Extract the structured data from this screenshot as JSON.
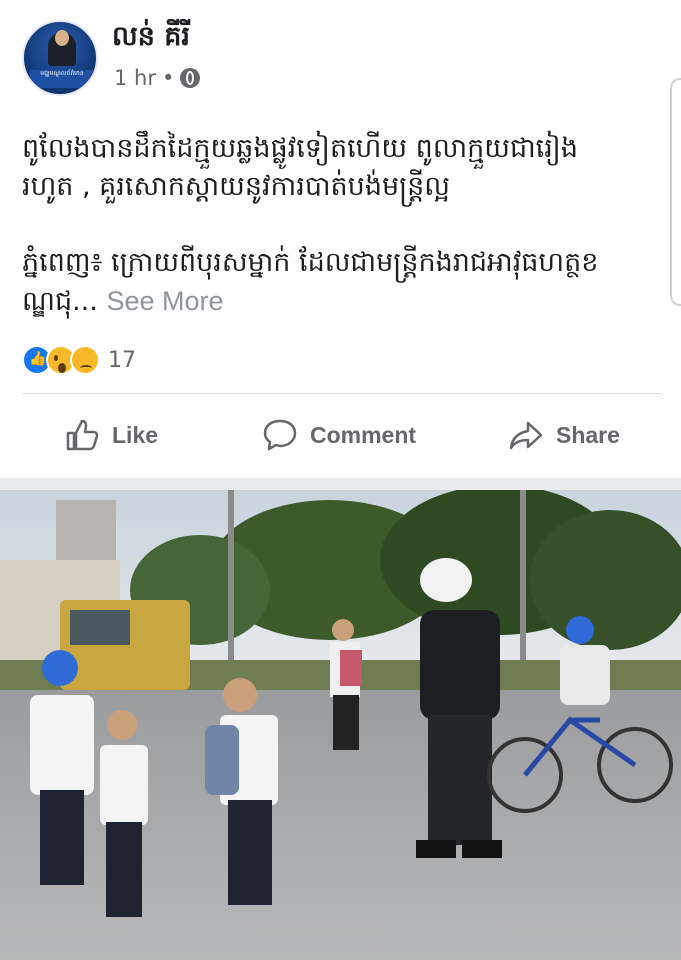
{
  "post": {
    "author": "លន់ គីរី",
    "timestamp": "1 hr",
    "separator": "•",
    "avatar_caption": "មជ្ឈមណ្ឌលព័ត៌មាន",
    "text_line1": "ពូលែងបានដឹកដៃក្មួយឆ្លងផ្លូវទៀតហើយ ពូលាក្មួយជារៀង",
    "text_line2": "រហូត , គួរសោកស្ដាយនូវការបាត់បង់មន្ត្រីល្អ",
    "text_line3": "ភ្នំពេញ៖ ក្រោយពីបុរសម្នាក់ ដែលជាមន្ត្រីកងរាជអាវុធហត្ថខ",
    "text_line4": "ណ្ឌជុ...",
    "see_more": "See More",
    "reaction_count": "17"
  },
  "actions": {
    "like": "Like",
    "comment": "Comment",
    "share": "Share"
  },
  "icons": {
    "privacy": "globe-icon",
    "like": "thumbs-up-icon",
    "comment": "speech-bubble-icon",
    "share": "share-arrow-icon"
  },
  "colors": {
    "like_blue": "#1877f2",
    "reaction_yellow": "#f7b928",
    "action_gray": "#65676b",
    "divider": "#dadde1"
  }
}
